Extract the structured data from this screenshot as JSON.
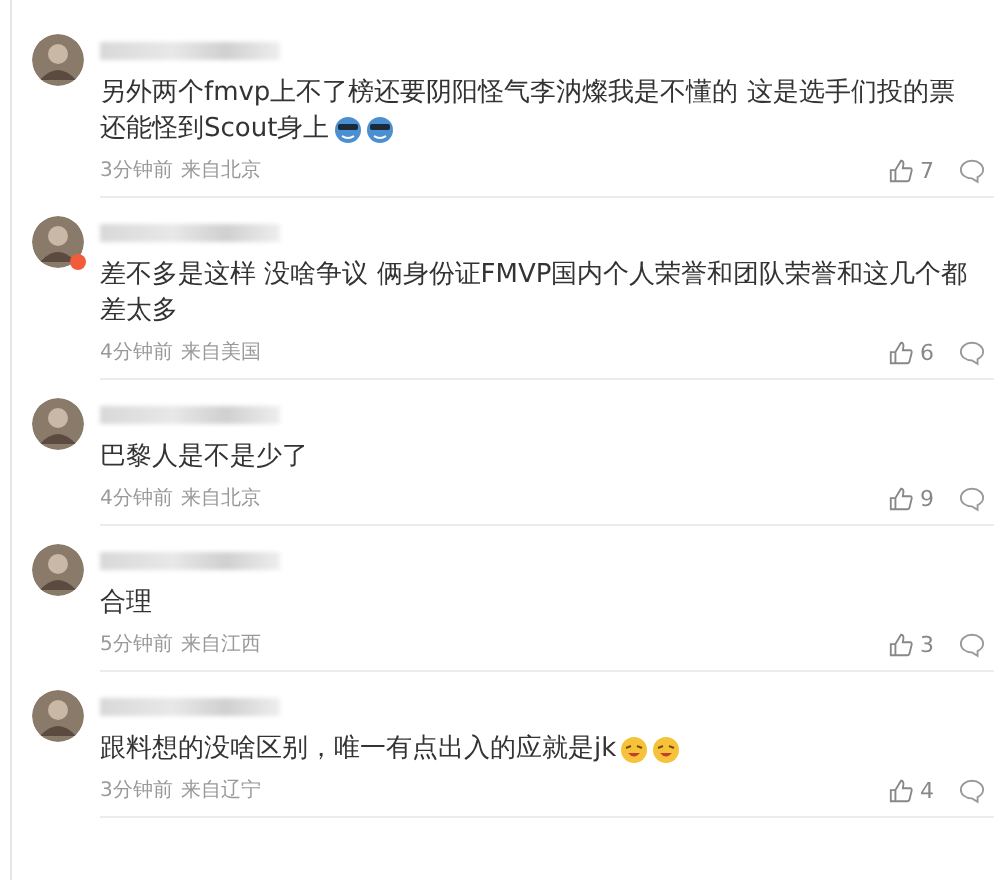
{
  "comments": [
    {
      "verified": false,
      "lines": [
        "另外两个fmvp上不了榜还要阴阳怪气李汭燦我是不懂的 这是选手们投的票",
        "还能怪到Scout身上"
      ],
      "emojis": [
        {
          "kind": "cool"
        },
        {
          "kind": "cool"
        }
      ],
      "time": "3分钟前",
      "location": "来自北京",
      "likes": "7"
    },
    {
      "verified": true,
      "lines": [
        "差不多是这样 没啥争议 俩身份证FMVP国内个人荣誉和团队荣誉和这几个都",
        "差太多"
      ],
      "time": "4分钟前",
      "location": "来自美国",
      "likes": "6"
    },
    {
      "verified": false,
      "lines": [
        "巴黎人是不是少了"
      ],
      "time": "4分钟前",
      "location": "来自北京",
      "likes": "9"
    },
    {
      "verified": false,
      "lines": [
        "合理"
      ],
      "time": "5分钟前",
      "location": "来自江西",
      "likes": "3"
    },
    {
      "verified": false,
      "lines": [
        "跟料想的没啥区别，唯一有点出入的应就是jk"
      ],
      "emojis": [
        {
          "kind": "grin"
        },
        {
          "kind": "grin"
        }
      ],
      "time": "3分钟前",
      "location": "来自辽宁",
      "likes": "4"
    }
  ]
}
